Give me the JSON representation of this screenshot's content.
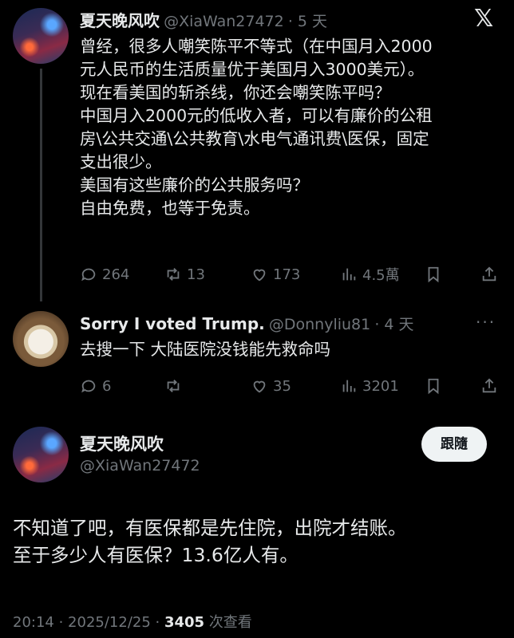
{
  "tweet1": {
    "name": "夏天晚风吹",
    "handle": "@XiaWan27472",
    "time": "· 5 天",
    "text": "曾经，很多人嘲笑陈平不等式（在中国月入2000\n元人民币的生活质量优于美国月入3000美元）。\n现在看美国的斩杀线，你还会嘲笑陈平吗？\n中国月入2000元的低收入者，可以有廉价的公租\n房\\公共交通\\公共教育\\水电气通讯费\\医保，固定\n支出很少。\n美国有这些廉价的公共服务吗？\n自由免费，也等于免责。",
    "replies": "264",
    "reposts": "13",
    "likes": "173",
    "views": "4.5萬"
  },
  "tweet2": {
    "name": "Sorry I voted Trump.",
    "handle": "@Donnyliu81",
    "time": "· 4 天",
    "text": "去搜一下 大陆医院没钱能先救命吗",
    "replies": "6",
    "reposts": "",
    "likes": "35",
    "views": "3201"
  },
  "tweet3": {
    "name": "夏天晚风吹",
    "handle": "@XiaWan27472",
    "follow_label": "跟隨",
    "text": "不知道了吧，有医保都是先住院，出院才结账。\n至于多少人有医保？13.6亿人有。",
    "footer_time": "20:14 · 2025/12/25 ·",
    "footer_views": "3405",
    "footer_views_label": "次查看"
  },
  "icons": {
    "x_logo": "𝕏",
    "more": "···"
  }
}
